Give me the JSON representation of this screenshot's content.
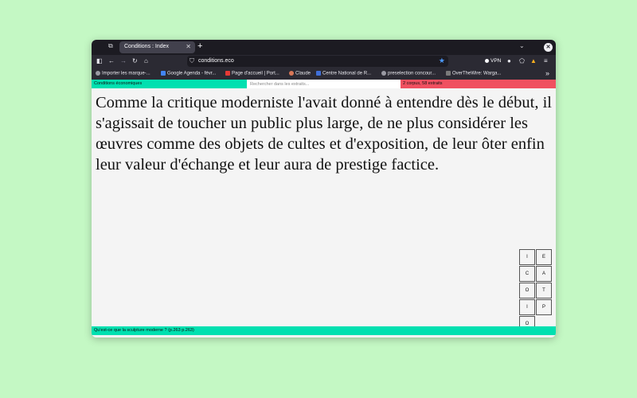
{
  "browser": {
    "tab_title": "Conditions : Index",
    "url": "conditions.eco",
    "vpn_label": "VPN",
    "bookmarks": [
      {
        "label": "Importer les marque-...",
        "color": "#9a9aa3"
      },
      {
        "label": "Google Agenda - févr...",
        "color": "#4285f4"
      },
      {
        "label": "Page d'accueil | Port...",
        "color": "#e53935"
      },
      {
        "label": "Claude",
        "color": "#d97757"
      },
      {
        "label": "Centre National de R...",
        "color": "#3f6fd8"
      },
      {
        "label": "preselection concour...",
        "color": "#9a9aa3"
      },
      {
        "label": "OverTheWire: Warga...",
        "color": "#7a7a7a"
      }
    ]
  },
  "app": {
    "title": "Conditions économiques",
    "search_placeholder": "Rechercher dans les extraits...",
    "count": "2 corpus, 58 extraits",
    "quote": "Comme la critique moderniste l'avait donné à entendre dès le début, il s'agissait de toucher un public plus large, de ne plus considérer les œuvres comme des objets de cultes et d'exposition, de leur ôter enfin leur valeur d'échange et leur aura de prestige factice.",
    "letters": [
      "I",
      "E",
      "C",
      "A",
      "O",
      "T",
      "I",
      "P",
      "O"
    ],
    "footer": "Qu'est-ce que la sculpture moderne ? (p.263 p.263)"
  },
  "colors": {
    "accent_green": "#00e0b0",
    "accent_red": "#f05060",
    "desktop_bg": "#c4f8c4"
  }
}
